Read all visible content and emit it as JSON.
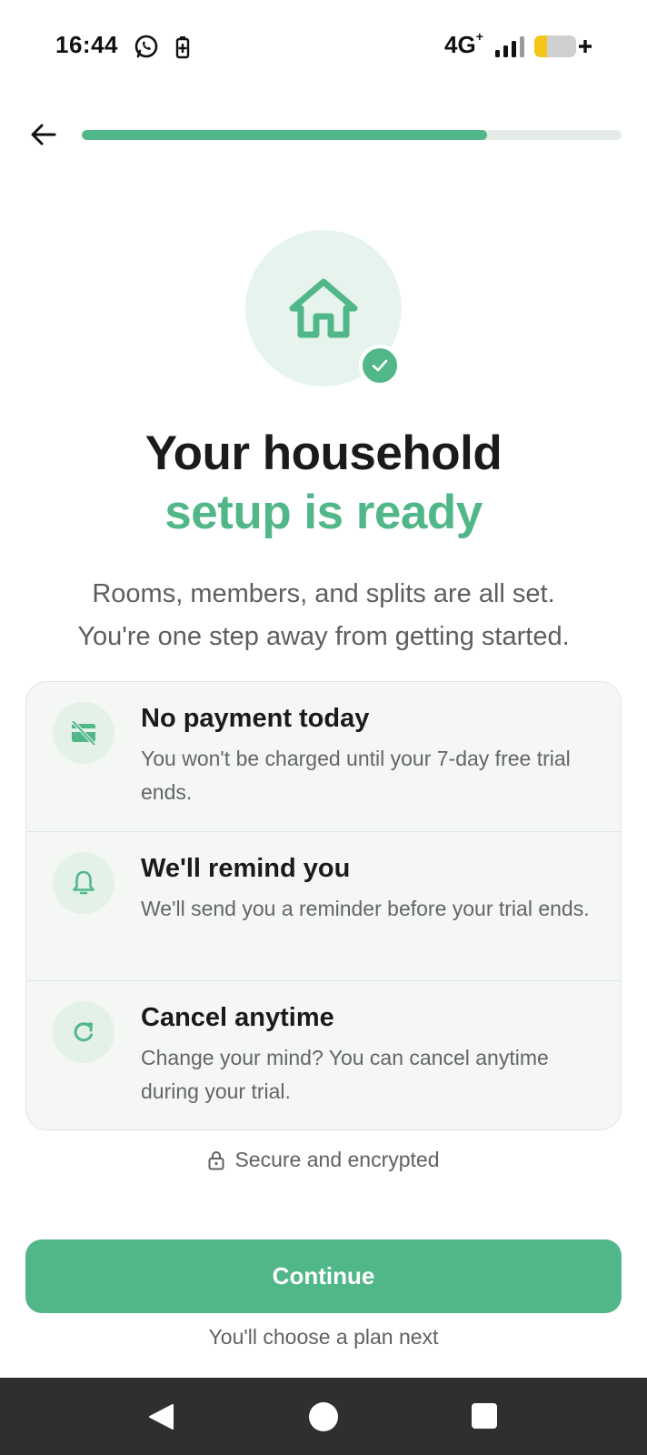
{
  "status_bar": {
    "time": "16:44",
    "network": "4G",
    "network_suffix": "+",
    "icons": [
      "whatsapp-icon",
      "battery-saver-icon",
      "signal-icon",
      "battery-icon"
    ]
  },
  "progress": {
    "fraction": 0.75
  },
  "colors": {
    "accent": "#52b788",
    "accent_light": "#e7f4ed",
    "card_bg": "#f4f7f4",
    "nav_bar": "#2f2f2f"
  },
  "hero": {
    "icon": "home-icon",
    "badge_icon": "check-icon",
    "title_line1": "Your household",
    "title_line2": "setup is ready",
    "subtitle_line1": "Rooms, members, and splits are all set.",
    "subtitle_line2": "You're one step away from getting started."
  },
  "features": [
    {
      "icon": "no-card-icon",
      "title": "No payment today",
      "description": "You won't be charged until your 7-day free trial ends."
    },
    {
      "icon": "bell-icon",
      "title": "We'll remind you",
      "description": "We'll send you a reminder before your trial ends."
    },
    {
      "icon": "refresh-icon",
      "title": "Cancel anytime",
      "description": "Change your mind? You can cancel anytime during your trial."
    }
  ],
  "secure_text": "Secure and encrypted",
  "continue_label": "Continue",
  "next_hint": "You'll choose a plan next"
}
